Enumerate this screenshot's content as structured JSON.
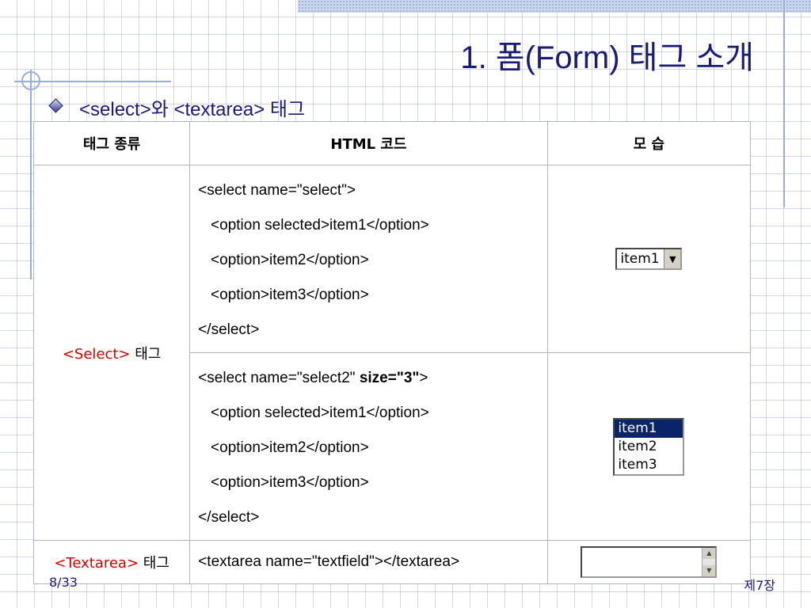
{
  "slide": {
    "title": "1. 폼(Form) 태그 소개",
    "subtitle": "<select>와 <textarea> 태그",
    "page": "8/33",
    "chapter": "제7장"
  },
  "table": {
    "headers": [
      "태그 종류",
      "HTML 코드",
      "모 습"
    ],
    "select_row": {
      "tag_red": "<Select>",
      "tag_black": "태그",
      "code1": [
        "<select name=\"select\">",
        "   <option selected>item1</option>",
        "   <option>item2</option>",
        "   <option>item3</option>",
        "</select>"
      ],
      "code2_first_prefix": "<select name=\"select2\" ",
      "code2_first_bold": "size=\"3\"",
      "code2_first_suffix": ">",
      "code2": [
        "   <option selected>item1</option>",
        "   <option>item2</option>",
        "   <option>item3</option>",
        "</select>"
      ],
      "preview_select_value": "item1",
      "preview_list_options": [
        "item1",
        "item2",
        "item3"
      ]
    },
    "textarea_row": {
      "tag_red": "<Textarea>",
      "tag_black": "태그",
      "code": "<textarea name=\"textfield\"></textarea>"
    }
  },
  "icons": {
    "bullet": "diamond-bullet-icon",
    "dropdown_arrow": "triangle-down-icon",
    "scroll_up": "triangle-up-icon",
    "scroll_down": "triangle-down-icon"
  },
  "colors": {
    "title": "#1a1a7a",
    "tag_highlight": "#d40000",
    "selected_option_bg": "#0a246a"
  }
}
